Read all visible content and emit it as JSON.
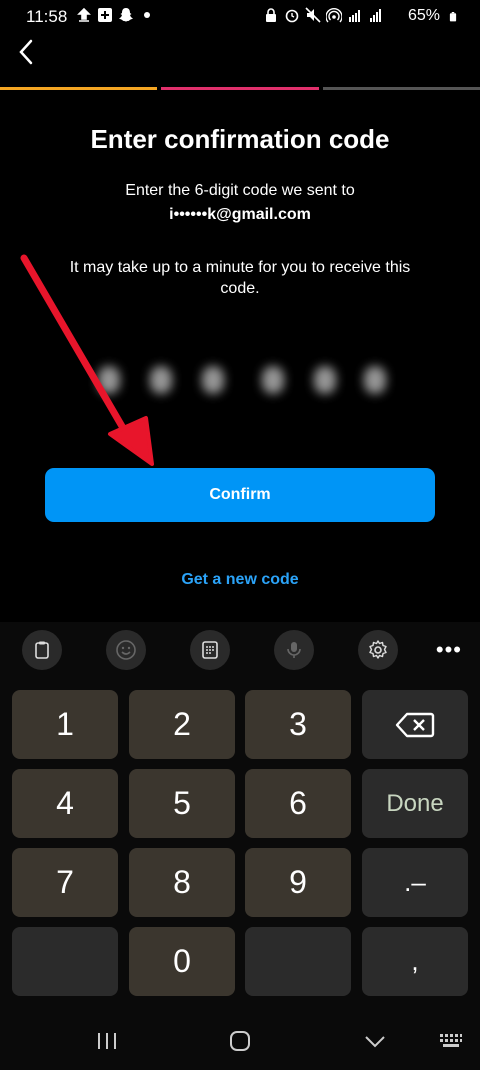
{
  "status_bar": {
    "time": "11:58",
    "battery": "65%"
  },
  "header": {
    "back_label": "Back"
  },
  "progress": {
    "colors": [
      "#f5a623",
      "#e1306c",
      "#555555"
    ]
  },
  "page": {
    "title": "Enter confirmation code",
    "subtitle": "Enter the 6-digit code we sent to",
    "email": "i••••••k@gmail.com",
    "note": "It may take up to a minute for you to receive this code."
  },
  "code_input": {
    "digits": 6
  },
  "confirm_button": {
    "label": "Confirm"
  },
  "new_code_link": {
    "label": "Get a new code"
  },
  "keyboard": {
    "toolbar": [
      "clipboard-icon",
      "emoji-icon",
      "keypad-icon",
      "mic-icon",
      "settings-icon",
      "more-icon"
    ],
    "more_label": "•••",
    "rows": [
      [
        "1",
        "2",
        "3",
        "⌫"
      ],
      [
        "4",
        "5",
        "6",
        "Done"
      ],
      [
        "7",
        "8",
        "9",
        ".–"
      ],
      [
        "",
        "0",
        "",
        ","
      ]
    ]
  },
  "colors": {
    "accent": "#0095f6",
    "link": "#2ba3f8",
    "key": "#3b362e",
    "arrow": "#e8152b"
  }
}
